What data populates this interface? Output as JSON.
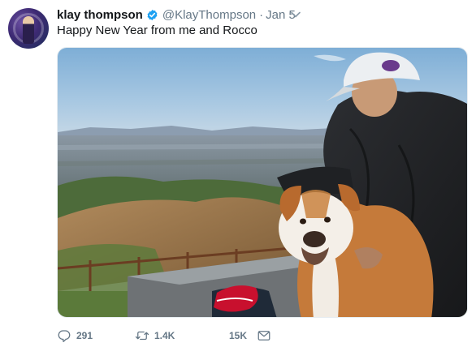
{
  "tweet": {
    "author_name": "klay thompson",
    "handle": "@KlayThompson",
    "separator": "·",
    "date": "Jan 5",
    "text": "Happy New Year from me and Rocco"
  },
  "actions": {
    "replies": "291",
    "retweets": "1.4K",
    "likes": "15K"
  },
  "colors": {
    "verified": "#1da1f2",
    "muted": "#657786",
    "text": "#14171a",
    "shoe_red": "#c8102e"
  },
  "icons": [
    "verified-badge-icon",
    "chevron-down-icon",
    "reply-icon",
    "retweet-icon",
    "like-icon",
    "message-icon"
  ]
}
